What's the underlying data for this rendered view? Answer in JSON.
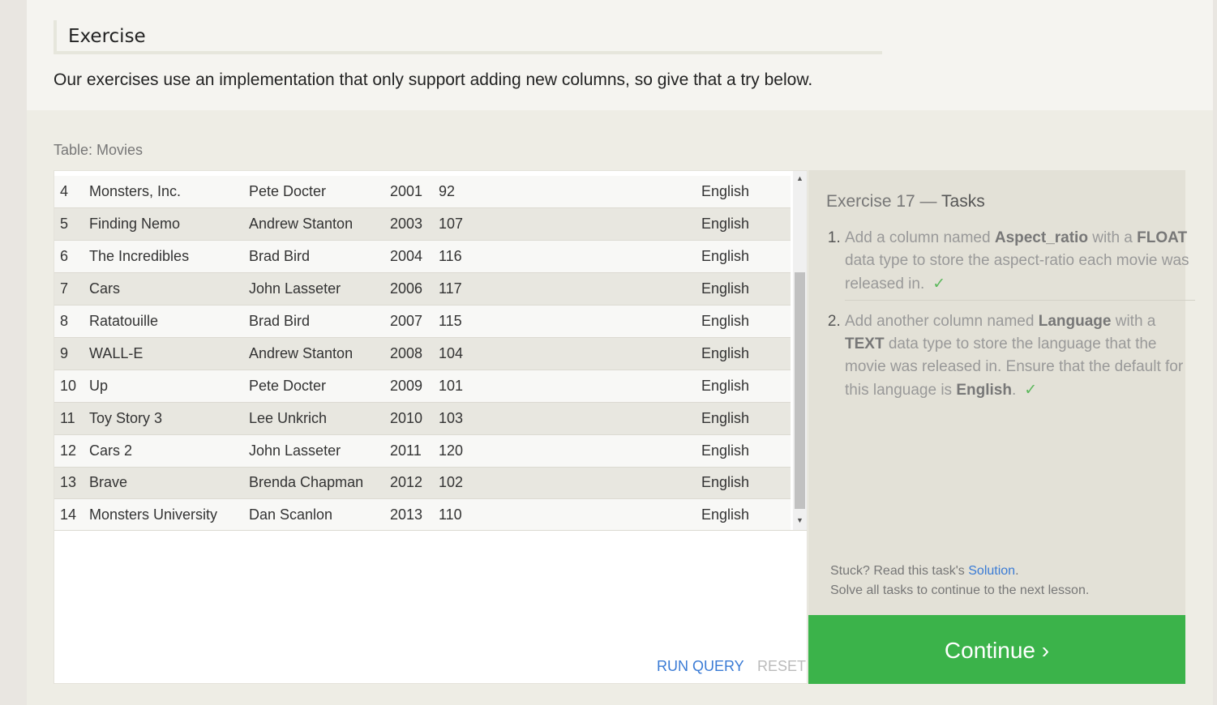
{
  "exercise": {
    "heading": "Exercise",
    "intro": "Our exercises use an implementation that only support adding new columns, so give that a try below."
  },
  "table": {
    "label": "Table: Movies",
    "rows": [
      {
        "id": "4",
        "title": "Monsters, Inc.",
        "director": "Pete Docter",
        "year": "2001",
        "length": "92",
        "language": "English"
      },
      {
        "id": "5",
        "title": "Finding Nemo",
        "director": "Andrew Stanton",
        "year": "2003",
        "length": "107",
        "language": "English"
      },
      {
        "id": "6",
        "title": "The Incredibles",
        "director": "Brad Bird",
        "year": "2004",
        "length": "116",
        "language": "English"
      },
      {
        "id": "7",
        "title": "Cars",
        "director": "John Lasseter",
        "year": "2006",
        "length": "117",
        "language": "English"
      },
      {
        "id": "8",
        "title": "Ratatouille",
        "director": "Brad Bird",
        "year": "2007",
        "length": "115",
        "language": "English"
      },
      {
        "id": "9",
        "title": "WALL-E",
        "director": "Andrew Stanton",
        "year": "2008",
        "length": "104",
        "language": "English"
      },
      {
        "id": "10",
        "title": "Up",
        "director": "Pete Docter",
        "year": "2009",
        "length": "101",
        "language": "English"
      },
      {
        "id": "11",
        "title": "Toy Story 3",
        "director": "Lee Unkrich",
        "year": "2010",
        "length": "103",
        "language": "English"
      },
      {
        "id": "12",
        "title": "Cars 2",
        "director": "John Lasseter",
        "year": "2011",
        "length": "120",
        "language": "English"
      },
      {
        "id": "13",
        "title": "Brave",
        "director": "Brenda Chapman",
        "year": "2012",
        "length": "102",
        "language": "English"
      },
      {
        "id": "14",
        "title": "Monsters University",
        "director": "Dan Scanlon",
        "year": "2013",
        "length": "110",
        "language": "English"
      }
    ],
    "scroll_up_icon": "▲",
    "scroll_down_icon": "▼"
  },
  "actions": {
    "run_query": "RUN QUERY",
    "reset": "RESET"
  },
  "tasks": {
    "title_prefix": "Exercise 17 — ",
    "title_accent": "Tasks",
    "items": [
      {
        "before": "Add a column named ",
        "bold1": "Aspect_ratio",
        "middle": " with a ",
        "bold2": "FLOAT",
        "after": " data type to store the aspect-ratio each movie was released in.",
        "check": "✓"
      },
      {
        "before": "Add another column named ",
        "bold1": "Language",
        "middle": " with a ",
        "bold2": "TEXT",
        "after": " data type to store the language that the movie was released in. Ensure that the default for this language is ",
        "bold3": "English",
        "end": ".",
        "check": "✓"
      }
    ],
    "stuck_prefix": "Stuck? Read this task's ",
    "solution_link": "Solution",
    "stuck_suffix": ".",
    "solve_all": "Solve all tasks to continue to the next lesson."
  },
  "continue_button": "Continue ›",
  "colors": {
    "continue": "#3bb34a",
    "link": "#3a7bd5",
    "check": "#5cb85c"
  }
}
